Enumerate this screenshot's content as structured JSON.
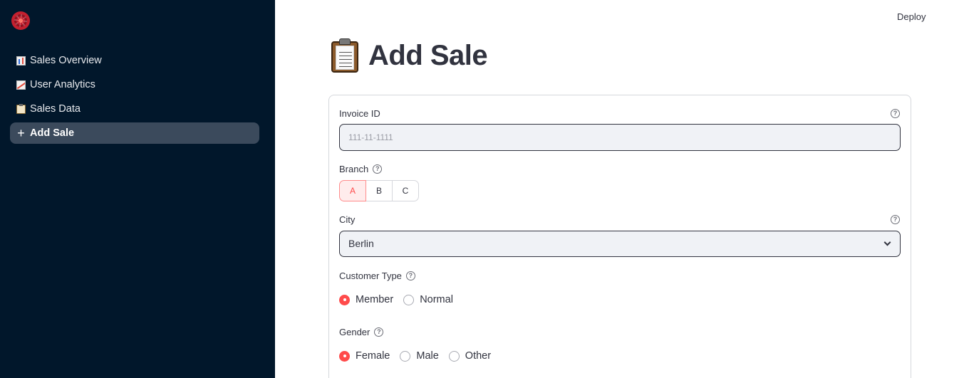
{
  "sidebar": {
    "items": [
      {
        "label": "Sales Overview",
        "icon": "bar-chart-icon"
      },
      {
        "label": "User Analytics",
        "icon": "line-chart-icon"
      },
      {
        "label": "Sales Data",
        "icon": "clipboard-icon"
      },
      {
        "label": "Add Sale",
        "icon": "plus-icon",
        "active": true
      }
    ]
  },
  "header": {
    "deploy_label": "Deploy"
  },
  "page": {
    "title": "Add Sale",
    "title_icon": "clipboard-icon"
  },
  "form": {
    "invoice": {
      "label": "Invoice ID",
      "placeholder": "111-11-1111",
      "value": ""
    },
    "branch": {
      "label": "Branch",
      "options": [
        "A",
        "B",
        "C"
      ],
      "selected": "A"
    },
    "city": {
      "label": "City",
      "value": "Berlin"
    },
    "customer_type": {
      "label": "Customer Type",
      "options": [
        "Member",
        "Normal"
      ],
      "selected": "Member"
    },
    "gender": {
      "label": "Gender",
      "options": [
        "Female",
        "Male",
        "Other"
      ],
      "selected": "Female"
    }
  },
  "colors": {
    "sidebar_bg": "#01172b",
    "accent": "#ff4b4b",
    "active_nav_bg": "#3b4a5c"
  }
}
